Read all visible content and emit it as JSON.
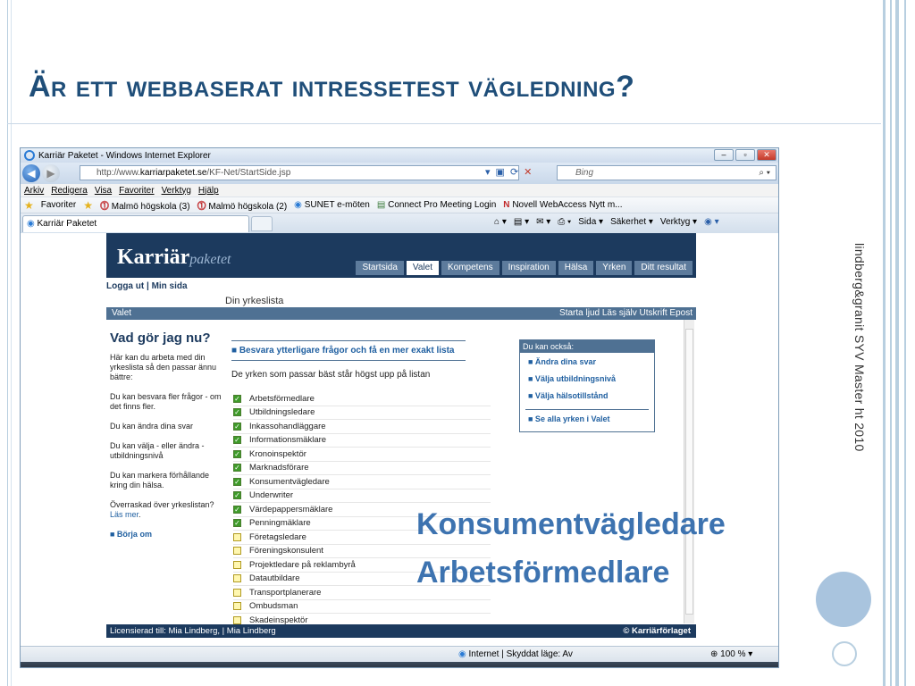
{
  "slide": {
    "title": "Är ett webbaserat intressetest vägledning?",
    "side_caption": "lindberg&granit SYV Master ht 2010",
    "callout_line1": "Konsumentvägledare",
    "callout_line2": "Arbetsförmedlare"
  },
  "browser": {
    "window_title": "Karriär Paketet - Windows Internet Explorer",
    "url_prefix": "http://www.",
    "url_domain": "karriarpaketet.se",
    "url_path": "/KF-Net/StartSide.jsp",
    "search_placeholder": "Bing",
    "menu": [
      "Arkiv",
      "Redigera",
      "Visa",
      "Favoriter",
      "Verktyg",
      "Hjälp"
    ],
    "favorites_label": "Favoriter",
    "favorites": [
      "Malmö högskola (3)",
      "Malmö högskola (2)",
      "SUNET e-möten",
      "Connect Pro Meeting Login",
      "Novell WebAccess Nytt m..."
    ],
    "tab_title": "Karriär Paketet",
    "commands": [
      "Sida ▾",
      "Säkerhet ▾",
      "Verktyg ▾"
    ],
    "status_zone": "Internet | Skyddat läge: Av",
    "zoom": "100 %"
  },
  "site": {
    "logo_main": "Karriär",
    "logo_sub": "paketet",
    "tabs": [
      "Startsida",
      "Valet",
      "Kompetens",
      "Inspiration",
      "Hälsa",
      "Yrken",
      "Ditt resultat"
    ],
    "active_tab": "Valet",
    "user_links": "Logga ut  |  Min sida",
    "page_heading": "Din yrkeslista",
    "section_title": "Valet",
    "section_tools": "Starta ljud  Läs själv  Utskrift  Epost",
    "left": {
      "heading": "Vad gör jag nu?",
      "p1": "Här kan du arbeta med din yrkeslista så den passar ännu bättre:",
      "p2": "Du kan besvara fler frågor - om det finns fler.",
      "p3": "Du kan ändra dina svar",
      "p4": "Du kan välja - eller ändra - utbildningsnivå",
      "p5": "Du kan markera förhållande kring din hälsa.",
      "p6_text": "Överraskad över yrkeslistan?",
      "p6_link": "Läs mer",
      "begin": "■ Börja om"
    },
    "more_questions": "■  Besvara ytterligare frågor och få en mer exakt lista",
    "list_intro": "De yrken som passar bäst står högst upp på listan",
    "jobs": [
      {
        "name": "Arbetsförmedlare",
        "checked": true
      },
      {
        "name": "Utbildningsledare",
        "checked": true
      },
      {
        "name": "Inkassohandläggare",
        "checked": true
      },
      {
        "name": "Informationsmäklare",
        "checked": true
      },
      {
        "name": "Kronoinspektör",
        "checked": true
      },
      {
        "name": "Marknadsförare",
        "checked": true
      },
      {
        "name": "Konsumentvägledare",
        "checked": true
      },
      {
        "name": "Underwriter",
        "checked": true
      },
      {
        "name": "Värdepappersmäklare",
        "checked": true
      },
      {
        "name": "Penningmäklare",
        "checked": true
      },
      {
        "name": "Företagsledare",
        "checked": false
      },
      {
        "name": "Föreningskonsulent",
        "checked": false
      },
      {
        "name": "Projektledare på reklambyrå",
        "checked": false
      },
      {
        "name": "Datautbildare",
        "checked": false
      },
      {
        "name": "Transportplanerare",
        "checked": false
      },
      {
        "name": "Ombudsman",
        "checked": false
      },
      {
        "name": "Skadeinspektör",
        "checked": false
      }
    ],
    "also_box": {
      "heading": "Du kan också:",
      "items": [
        "■ Ändra dina svar",
        "■ Välja utbildningsnivå",
        "■ Välja hälsotillstånd"
      ],
      "all_jobs": "■ Se alla yrken i Valet"
    },
    "footer_left": "Licensierad till:  Mia Lindberg,  |  Mia Lindberg",
    "footer_right": "© Karriärförlaget"
  }
}
